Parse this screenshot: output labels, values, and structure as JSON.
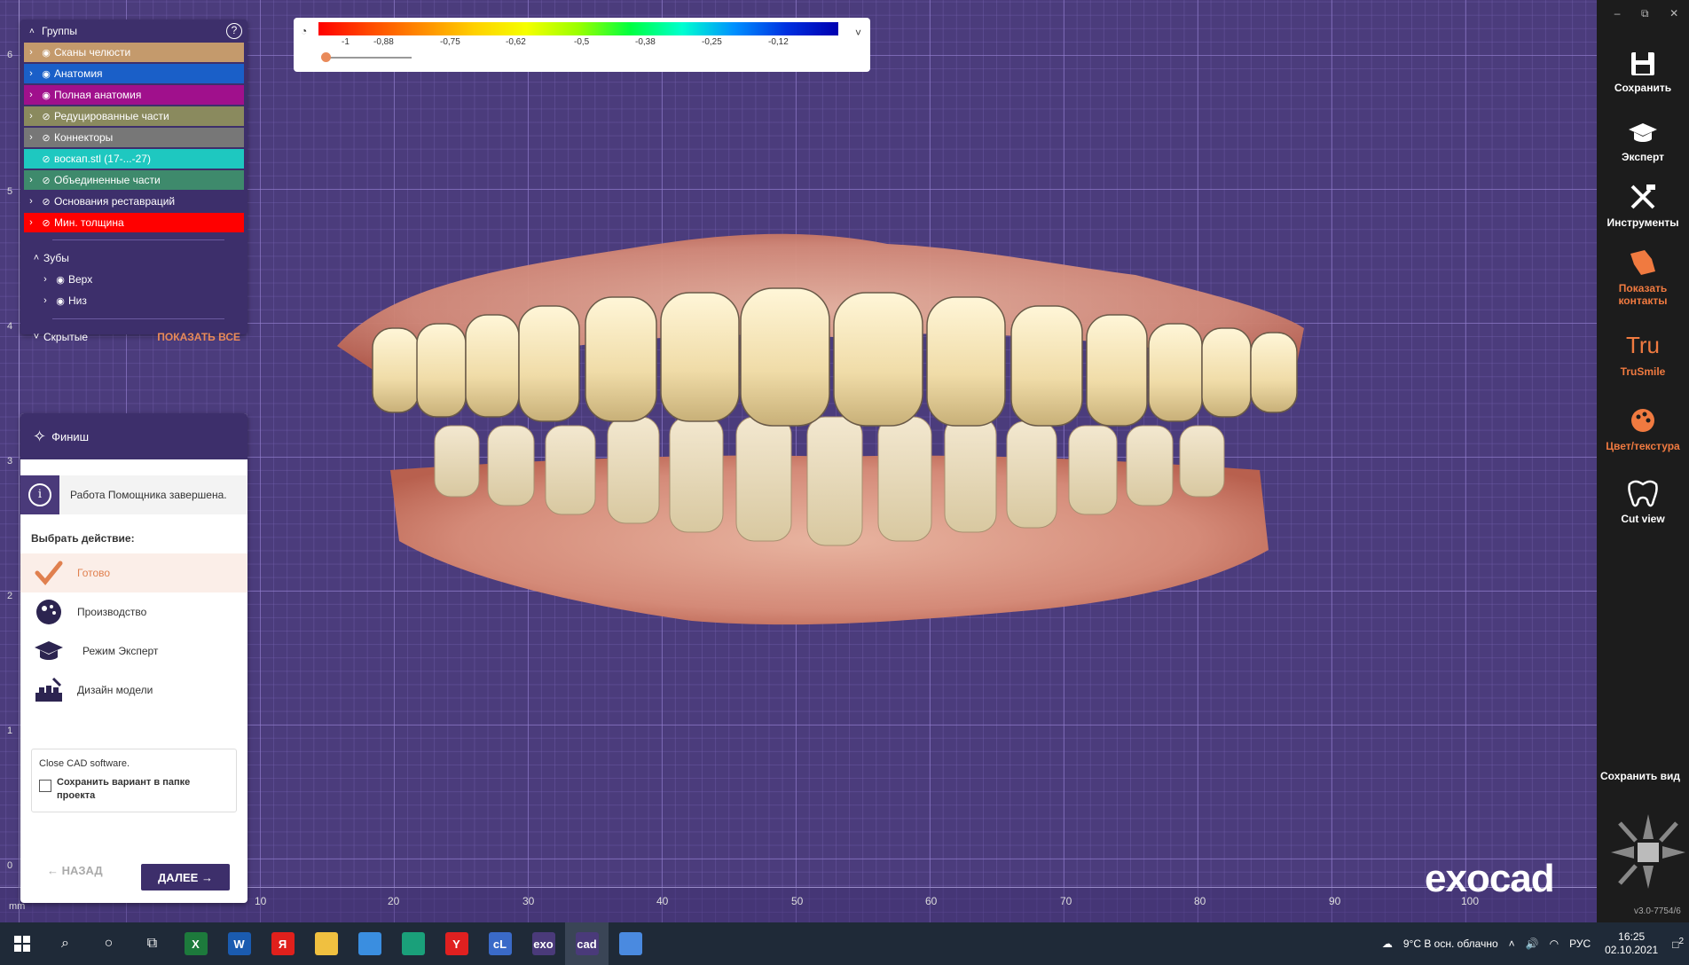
{
  "groups_panel": {
    "title": "Группы",
    "groups": [
      {
        "label": "Сканы челюсти",
        "color": "#c49a6c",
        "visible": true
      },
      {
        "label": "Анатомия",
        "color": "#1a5fc8",
        "visible": true
      },
      {
        "label": "Полная анатомия",
        "color": "#a0108c",
        "visible": true
      },
      {
        "label": "Редуцированные части",
        "color": "#8a8a5e",
        "visible": false
      },
      {
        "label": "Коннекторы",
        "color": "#777777",
        "visible": false
      },
      {
        "label": "воскап.stl (17-...-27)",
        "color": "#1ec8c0",
        "visible": false
      },
      {
        "label": "Объединенные части",
        "color": "#3e8a6c",
        "visible": false
      },
      {
        "label": "Основания реставраций",
        "color": "#3d2f6b",
        "visible": false
      },
      {
        "label": "Мин. толщина",
        "color": "#ff0000",
        "visible": false
      }
    ],
    "teeth_label": "Зубы",
    "teeth": [
      {
        "label": "Верх"
      },
      {
        "label": "Низ"
      }
    ],
    "hidden_label": "Скрытые",
    "show_all": "ПОКАЗАТЬ ВСЕ"
  },
  "scale": {
    "ticks": [
      "-1",
      "-0,88",
      "-0,75",
      "-0,62",
      "-0,5",
      "-0,38",
      "-0,25",
      "-0,12"
    ]
  },
  "wizard": {
    "title": "Финиш",
    "info": "Работа Помощника завершена.",
    "choose_label": "Выбрать действие:",
    "actions": [
      {
        "label": "Готово",
        "icon": "checkmark-icon",
        "selected": true
      },
      {
        "label": "Производство",
        "icon": "production-icon",
        "selected": false
      },
      {
        "label": "Режим Эксперт",
        "icon": "graduation-cap-icon",
        "selected": false
      },
      {
        "label": "Дизайн модели",
        "icon": "model-design-icon",
        "selected": false
      }
    ],
    "close_text": "Close CAD software.",
    "save_checkbox_label": "Сохранить вариант в папке проекта",
    "back": "НАЗАД",
    "next": "ДАЛЕЕ"
  },
  "rulers": {
    "left": [
      "6",
      "5",
      "4",
      "3",
      "2",
      "1",
      "0"
    ],
    "bottom": [
      "10",
      "20",
      "30",
      "40",
      "50",
      "60",
      "70",
      "80",
      "90",
      "100"
    ],
    "unit": "mm"
  },
  "toolbar": {
    "save": "Сохранить",
    "expert": "Эксперт",
    "tools": "Инструменты",
    "show_contacts": "Показать контакты",
    "trusmile": "TruSmile",
    "trusmile_logo": "Tru",
    "color_texture": "Цвет/текстура",
    "cut_view": "Cut view",
    "save_view": "Сохранить вид",
    "version": "v3.0-7754/6"
  },
  "logo": "exocad",
  "taskbar": {
    "apps": [
      {
        "label": "X",
        "color": "#1d7a3c"
      },
      {
        "label": "W",
        "color": "#1a5bb0"
      },
      {
        "label": "Я",
        "color": "#e0201c"
      },
      {
        "label": "",
        "color": "#f0c040"
      },
      {
        "label": "",
        "color": "#3a8ee0"
      },
      {
        "label": "",
        "color": "#1aa07a"
      },
      {
        "label": "Y",
        "color": "#e02020"
      },
      {
        "label": "cL",
        "color": "#3a6ac8"
      },
      {
        "label": "exo",
        "color": "#4a3a7a"
      },
      {
        "label": "cad",
        "color": "#4a3a7a"
      },
      {
        "label": "",
        "color": "#4a8ae0"
      }
    ],
    "weather": "9°C  В осн. облачно",
    "lang": "РУС",
    "time": "16:25",
    "date": "02.10.2021",
    "notifications": "2"
  }
}
